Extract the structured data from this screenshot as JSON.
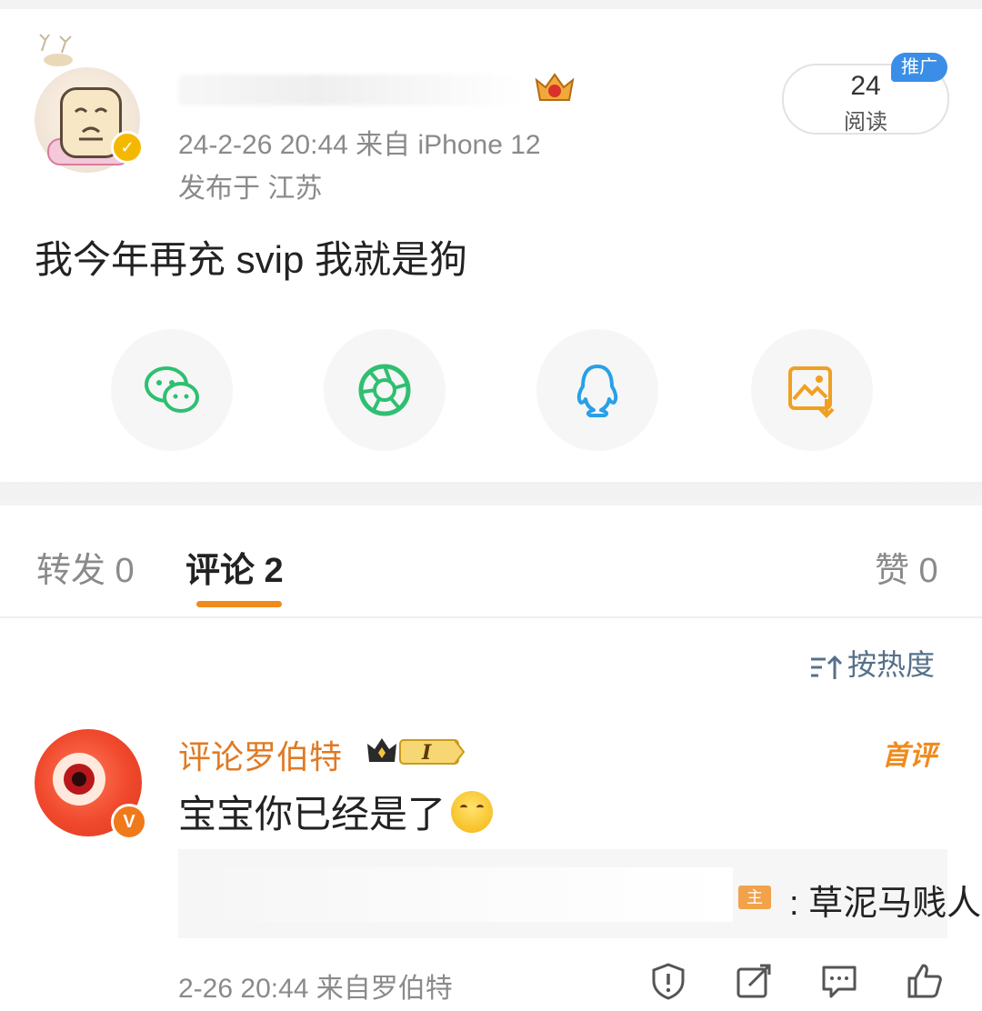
{
  "post": {
    "meta": "24-2-26 20:44  来自 iPhone 12",
    "location": "发布于 江苏",
    "text": "我今年再充 svip 我就是狗",
    "read_count": "24",
    "read_label": "阅读",
    "promo_tag": "推广"
  },
  "share": {
    "icons": [
      "wechat-icon",
      "moments-icon",
      "qq-icon",
      "save-image-icon"
    ],
    "colors": {
      "wechat": "#2fbf71",
      "moments": "#2fbf71",
      "qq": "#28a0e8",
      "save": "#f0a020"
    }
  },
  "tabs": {
    "repost": "转发 0",
    "comment": "评论 2",
    "like": "赞 0"
  },
  "sort": {
    "label": "按热度"
  },
  "comment": {
    "name": "评论罗伯特",
    "level": "I",
    "first_tag": "首评",
    "text": "宝宝你已经是了",
    "reply_label": "主",
    "reply_text": ": 草泥马贱人",
    "meta": "2-26 20:44  来自罗伯特"
  },
  "colors": {
    "accent": "#f08a1c",
    "name_orange": "#e07a23",
    "meta_gray": "#8a8a8a",
    "sort_blue": "#56708a"
  }
}
